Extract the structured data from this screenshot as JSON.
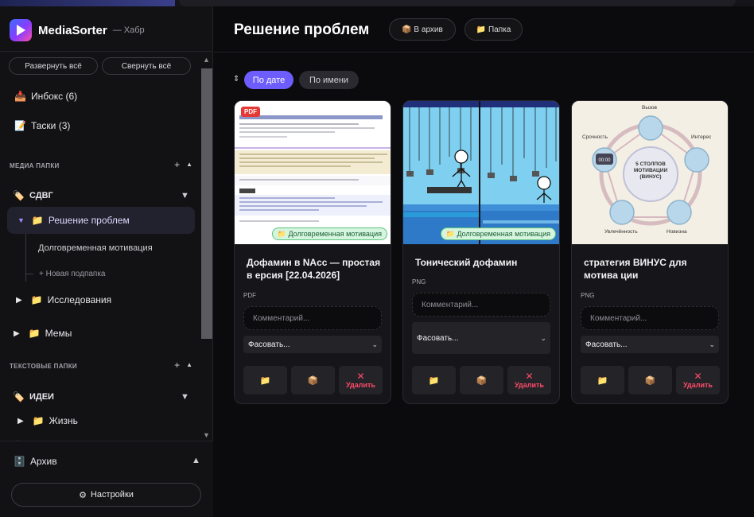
{
  "app": {
    "name": "MediaSorter",
    "subtitle": "— Хабр"
  },
  "sidebar": {
    "expand_all": "Развернуть всё",
    "collapse_all": "Свернуть всё",
    "inbox": {
      "icon": "📥",
      "label": "Инбокс (6)"
    },
    "tasks": {
      "icon": "📝",
      "label": "Таски (3)"
    },
    "media_section": {
      "title": "МЕДИА ПАПКИ",
      "add": "+",
      "collapse": "▲"
    },
    "sdvg": {
      "icon": "🏷️",
      "label": "СДВГ",
      "toggle": "▼"
    },
    "active_folder": {
      "arrow": "▼",
      "icon": "📁",
      "label": "Решение проблем"
    },
    "subfolder": "Долговременная мотивация",
    "new_subfolder": "+ Новая подпапка",
    "research": {
      "arrow": "▶",
      "icon": "📁",
      "label": "Исследования"
    },
    "memes": {
      "arrow": "▶",
      "icon": "📁",
      "label": "Мемы"
    },
    "text_section": {
      "title": "ТЕКСТОВЫЕ ПАПКИ",
      "add": "+",
      "collapse": "▲"
    },
    "ideas": {
      "icon": "🏷️",
      "label": "ИДЕИ",
      "toggle": "▼"
    },
    "life": {
      "arrow": "▶",
      "icon": "📁",
      "label": "Жизнь"
    },
    "archive": {
      "icon": "🗄️",
      "label": "Архив",
      "toggle": "▲"
    },
    "settings": {
      "icon": "⚙",
      "label": "Настройки"
    }
  },
  "header": {
    "title": "Решение проблем",
    "archive_btn": "📦 В архив",
    "folder_btn": "📁 Папка"
  },
  "sort": {
    "icon": "⇕",
    "by_date": "По дате",
    "by_name": "По имени"
  },
  "cards": [
    {
      "title": "Дофамин в NAcc — простая в ерсия [22.04.2026]",
      "type": "PDF",
      "badge": "📁 Долговременная мотивация",
      "pdf_label": "PDF",
      "comment_placeholder": "Комментарий...",
      "select": "Фасовать...",
      "delete": "Удалить"
    },
    {
      "title": "Тонический дофамин",
      "type": "PNG",
      "badge": "📁 Долговременная мотивация",
      "comment_placeholder": "Комментарий...",
      "select": "Фасовать...",
      "delete": "Удалить"
    },
    {
      "title": "стратегия ВИНУС для мотива ции",
      "type": "PNG",
      "comment_placeholder": "Комментарий...",
      "select": "Фасовать...",
      "delete": "Удалить"
    }
  ],
  "infographic": {
    "center": "5 СТОЛПОВ МОТИВАЦИИ (ВИНУС)",
    "labels": [
      "Вызов",
      "Интерес",
      "Новизна",
      "Увлечённость",
      "Срочность"
    ]
  },
  "colors": {
    "accent": "#6d5dfc",
    "danger": "#ff4a6a",
    "badge_bg": "#d6f5df"
  }
}
